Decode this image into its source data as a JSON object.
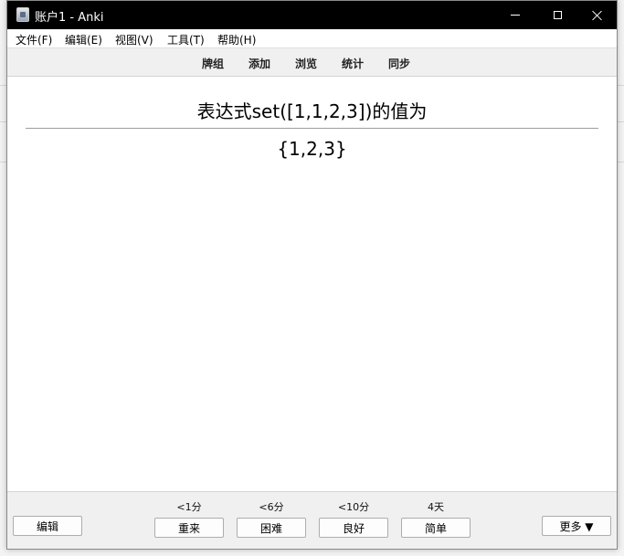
{
  "window": {
    "title": "账户1 - Anki"
  },
  "menu": {
    "items": [
      "文件(F)",
      "编辑(E)",
      "视图(V)",
      "工具(T)",
      "帮助(H)"
    ]
  },
  "toolbar": {
    "items": [
      "牌组",
      "添加",
      "浏览",
      "统计",
      "同步"
    ]
  },
  "card": {
    "question": "表达式set([1,1,2,3])的值为",
    "answer": "{1,2,3}"
  },
  "bottom": {
    "edit_label": "编辑",
    "more_label": "更多 ▼",
    "answers": [
      {
        "interval": "<1分",
        "label": "重来"
      },
      {
        "interval": "<6分",
        "label": "困难"
      },
      {
        "interval": "<10分",
        "label": "良好"
      },
      {
        "interval": "4天",
        "label": "简单"
      }
    ]
  }
}
